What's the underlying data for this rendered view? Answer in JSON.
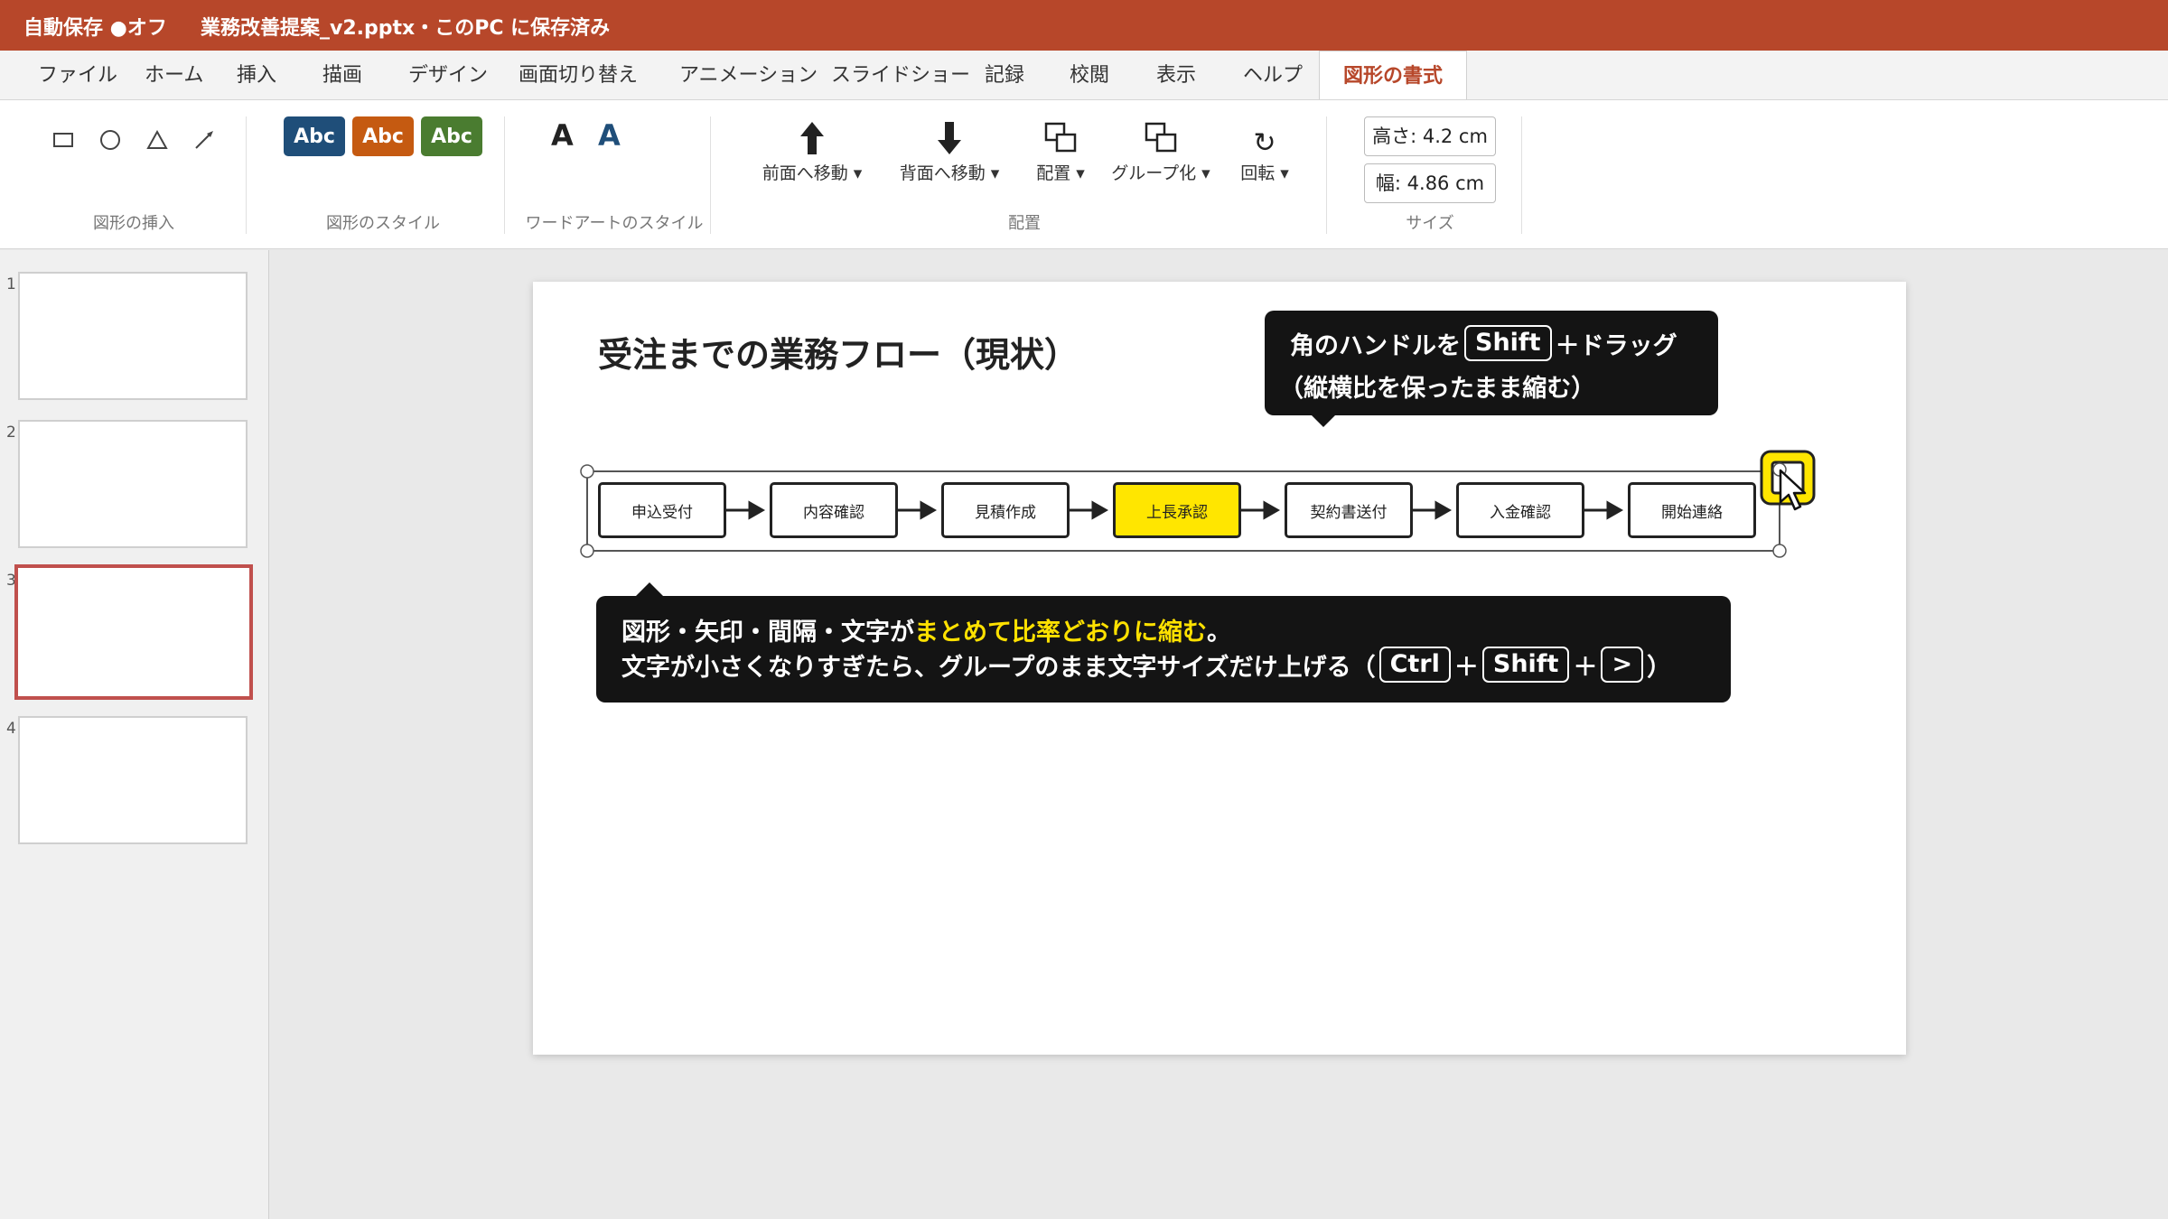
{
  "titlebar": {
    "autosave": "自動保存 ●オフ",
    "document": "業務改善提案_v2.pptx・このPC に保存済み"
  },
  "tabs": [
    {
      "label": "ファイル"
    },
    {
      "label": "ホーム"
    },
    {
      "label": "挿入"
    },
    {
      "label": "描画"
    },
    {
      "label": "デザイン"
    },
    {
      "label": "画面切り替え"
    },
    {
      "label": "アニメーション"
    },
    {
      "label": "スライドショー"
    },
    {
      "label": "記録"
    },
    {
      "label": "校閲"
    },
    {
      "label": "表示"
    },
    {
      "label": "ヘルプ"
    },
    {
      "label": "図形の書式",
      "active": true
    }
  ],
  "ribbon": {
    "insert_shapes": {
      "label": "図形の挿入",
      "icons": [
        "rectangle-icon",
        "circle-icon",
        "triangle-icon",
        "line-icon"
      ]
    },
    "shape_styles": {
      "label": "図形のスタイル",
      "items": [
        {
          "text": "Abc",
          "color": "#1f4e79"
        },
        {
          "text": "Abc",
          "color": "#c55a11"
        },
        {
          "text": "Abc",
          "color": "#4a7c30"
        }
      ]
    },
    "wordart": {
      "label": "ワードアートのスタイル",
      "items": [
        {
          "text": "A",
          "color": "#222222"
        },
        {
          "text": "A",
          "color": "#1f4e79"
        }
      ]
    },
    "arrange": {
      "label": "配置",
      "buttons": [
        {
          "label": "前面へ移動",
          "icon": "bring-forward-icon"
        },
        {
          "label": "背面へ移動",
          "icon": "send-backward-icon"
        },
        {
          "label": "配置",
          "icon": "align-icon"
        },
        {
          "label": "グループ化",
          "icon": "group-icon"
        },
        {
          "label": "回転",
          "icon": "rotate-icon"
        }
      ]
    },
    "size": {
      "label": "サイズ",
      "height": "高さ: 4.2 cm",
      "width": "幅: 4.86 cm"
    }
  },
  "slides": [
    {
      "number": "1"
    },
    {
      "number": "2"
    },
    {
      "number": "3",
      "selected": true
    },
    {
      "number": "4"
    }
  ],
  "slide": {
    "title": "受注までの業務フロー（現状）",
    "callout_top": {
      "line1_pre": "角のハンドルを",
      "line1_key": "Shift",
      "line1_post": "＋ドラッグ",
      "line2": "（縦横比を保ったまま縮む）"
    },
    "flow": [
      {
        "label": "申込受付"
      },
      {
        "label": "内容確認"
      },
      {
        "label": "見積作成"
      },
      {
        "label": "上長承認",
        "highlight": true
      },
      {
        "label": "契約書送付"
      },
      {
        "label": "入金確認"
      },
      {
        "label": "開始連絡"
      }
    ],
    "callout_bottom": {
      "line1_pre": "図形・矢印・間隔・文字が",
      "line1_highlight": "まとめて比率どおりに縮む",
      "line1_post": "。",
      "line2_pre": "文字が小さくなりすぎたら、グループのまま文字サイズだけ上げる（",
      "key1": "Ctrl",
      "plus1": "＋",
      "key2": "Shift",
      "plus2": "＋",
      "key3": ">",
      "line2_post": "）"
    }
  },
  "colors": {
    "accent": "#b7472a",
    "highlight": "#ffe600",
    "callout_bg": "#141414"
  }
}
